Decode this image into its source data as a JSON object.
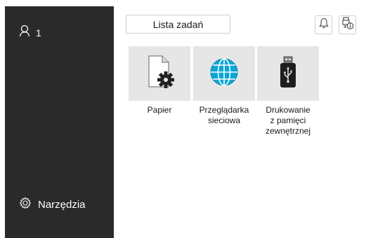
{
  "sidebar": {
    "user_count": "1",
    "user_icon": "user-icon",
    "tools_label": "Narzędzia",
    "tools_icon": "gear-outline-icon"
  },
  "header": {
    "job_list_label": "Lista zadań",
    "notification_icon": "bell-icon",
    "device_info_icon": "device-info-icon"
  },
  "tiles": [
    {
      "label": "Papier",
      "icon": "paper-settings-icon"
    },
    {
      "label": "Przeglądarka\nsieciowa",
      "icon": "web-browser-globe-icon"
    },
    {
      "label": "Drukowanie\nz pamięci\nzewnętrznej",
      "icon": "usb-memory-icon"
    }
  ],
  "colors": {
    "sidebar_bg": "#2a2a2a",
    "tile_bg": "#e6e6e6",
    "globe_blue": "#0aa6d8"
  }
}
